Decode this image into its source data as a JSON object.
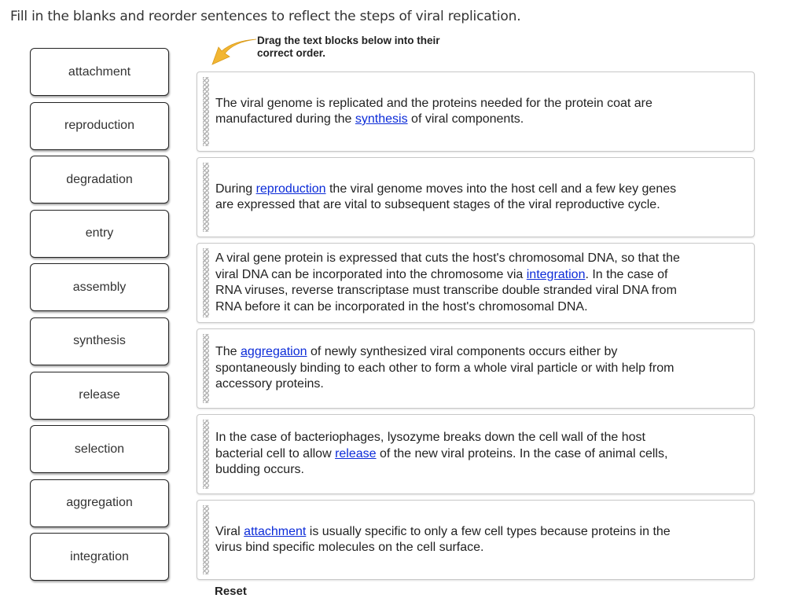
{
  "instruction": "Fill in the blanks and reorder sentences to reflect the steps of viral replication.",
  "hint": {
    "line1": "Drag the text blocks below into their",
    "line2": "correct order.",
    "arrow_color": "#f2b632"
  },
  "word_bank": [
    "attachment",
    "reproduction",
    "degradation",
    "entry",
    "assembly",
    "synthesis",
    "release",
    "selection",
    "aggregation",
    "integration"
  ],
  "blocks": [
    {
      "before": "The viral genome is replicated and the proteins needed for the protein coat are manufactured during the ",
      "blank": "synthesis",
      "after": " of viral components."
    },
    {
      "before": "During ",
      "blank": "reproduction",
      "after": " the viral genome moves into the host cell and a few key genes are expressed that are vital to subsequent stages of the viral reproductive cycle."
    },
    {
      "before": "A viral gene protein is expressed that cuts the host's chromosomal DNA, so that the viral DNA can be incorporated into the chromosome via ",
      "blank": "integration",
      "after": ". In the case of RNA viruses, reverse transcriptase must transcribe double stranded viral DNA from RNA before it can be incorporated in the host's chromosomal DNA."
    },
    {
      "before": "The ",
      "blank": "aggregation",
      "after": " of newly synthesized viral components occurs either by spontaneously binding to each other to form a whole viral particle or with help from accessory proteins."
    },
    {
      "before": "In the case of bacteriophages, lysozyme breaks down the cell wall of the host bacterial cell to allow ",
      "blank": "release",
      "after": " of the new viral proteins. In the case of animal cells, budding occurs."
    },
    {
      "before": "Viral ",
      "blank": "attachment",
      "after": " is usually specific to only a few cell types because proteins in the virus bind specific molecules on the cell surface."
    }
  ],
  "reset_label": "Reset",
  "link_color": "#0b2bd8"
}
